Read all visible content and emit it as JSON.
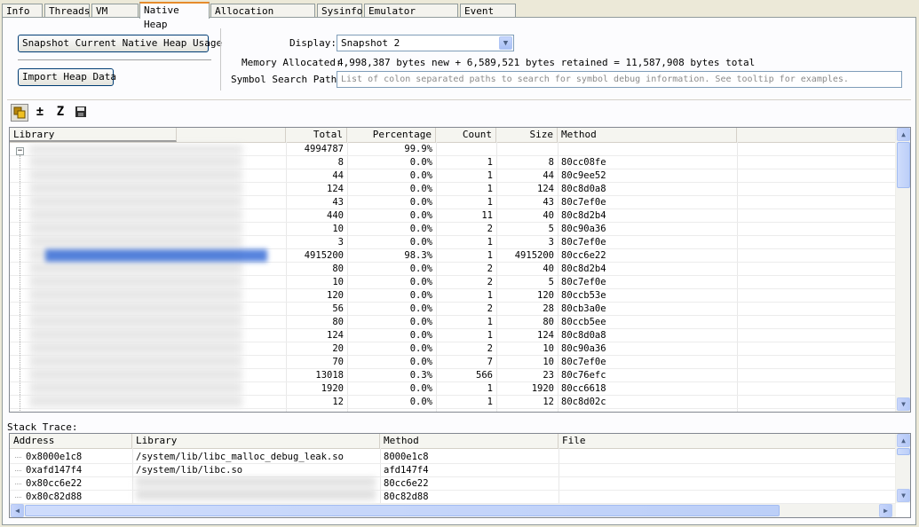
{
  "tabs": [
    "Info",
    "Threads",
    "VM Heap",
    "Native Heap",
    "Allocation Tracker",
    "Sysinfo",
    "Emulator Control",
    "Event Log"
  ],
  "buttons": {
    "snapshot": "Snapshot Current Native Heap Usage",
    "import": "Import Heap Data"
  },
  "display": {
    "label": "Display:",
    "value": "Snapshot 2"
  },
  "memory": {
    "label": "Memory Allocated:",
    "value": "4,998,387 bytes new + 6,589,521 bytes retained = 11,587,908 bytes total"
  },
  "symbol": {
    "label": "Symbol Search Path:",
    "placeholder": "List of colon separated paths to search for symbol debug information. See tooltip for examples."
  },
  "toolbar": {
    "icons": [
      "stacked-library-icon",
      "plus-minus-icon",
      "zygote-z-icon",
      "save-disk-icon"
    ],
    "plusminus_glyph": "±",
    "z_glyph": "Z"
  },
  "heap_table": {
    "columns": [
      "Library",
      "Total",
      "Percentage",
      "Count",
      "Size",
      "Method"
    ],
    "rows": [
      {
        "total": "4994787",
        "pct": "99.9%",
        "count": "",
        "size": "",
        "method": ""
      },
      {
        "total": "8",
        "pct": "0.0%",
        "count": "1",
        "size": "8",
        "method": "80cc08fe"
      },
      {
        "total": "44",
        "pct": "0.0%",
        "count": "1",
        "size": "44",
        "method": "80c9ee52"
      },
      {
        "total": "124",
        "pct": "0.0%",
        "count": "1",
        "size": "124",
        "method": "80c8d0a8"
      },
      {
        "total": "43",
        "pct": "0.0%",
        "count": "1",
        "size": "43",
        "method": "80c7ef0e"
      },
      {
        "total": "440",
        "pct": "0.0%",
        "count": "11",
        "size": "40",
        "method": "80c8d2b4"
      },
      {
        "total": "10",
        "pct": "0.0%",
        "count": "2",
        "size": "5",
        "method": "80c90a36"
      },
      {
        "total": "3",
        "pct": "0.0%",
        "count": "1",
        "size": "3",
        "method": "80c7ef0e"
      },
      {
        "total": "4915200",
        "pct": "98.3%",
        "count": "1",
        "size": "4915200",
        "method": "80cc6e22"
      },
      {
        "total": "80",
        "pct": "0.0%",
        "count": "2",
        "size": "40",
        "method": "80c8d2b4"
      },
      {
        "total": "10",
        "pct": "0.0%",
        "count": "2",
        "size": "5",
        "method": "80c7ef0e"
      },
      {
        "total": "120",
        "pct": "0.0%",
        "count": "1",
        "size": "120",
        "method": "80ccb53e"
      },
      {
        "total": "56",
        "pct": "0.0%",
        "count": "2",
        "size": "28",
        "method": "80cb3a0e"
      },
      {
        "total": "80",
        "pct": "0.0%",
        "count": "1",
        "size": "80",
        "method": "80ccb5ee"
      },
      {
        "total": "124",
        "pct": "0.0%",
        "count": "1",
        "size": "124",
        "method": "80c8d0a8"
      },
      {
        "total": "20",
        "pct": "0.0%",
        "count": "2",
        "size": "10",
        "method": "80c90a36"
      },
      {
        "total": "70",
        "pct": "0.0%",
        "count": "7",
        "size": "10",
        "method": "80c7ef0e"
      },
      {
        "total": "13018",
        "pct": "0.3%",
        "count": "566",
        "size": "23",
        "method": "80c76efc"
      },
      {
        "total": "1920",
        "pct": "0.0%",
        "count": "1",
        "size": "1920",
        "method": "80cc6618"
      },
      {
        "total": "12",
        "pct": "0.0%",
        "count": "1",
        "size": "12",
        "method": "80c8d02c"
      }
    ]
  },
  "stack": {
    "label": "Stack Trace:",
    "columns": [
      "Address",
      "Library",
      "Method",
      "File"
    ],
    "rows": [
      {
        "address": "0x8000e1c8",
        "library": "/system/lib/libc_malloc_debug_leak.so",
        "method": "8000e1c8",
        "file": ""
      },
      {
        "address": "0xafd147f4",
        "library": "/system/lib/libc.so",
        "method": "afd147f4",
        "file": ""
      },
      {
        "address": "0x80cc6e22",
        "library": "",
        "method": "80cc6e22",
        "file": ""
      },
      {
        "address": "0x80c82d88",
        "library": "",
        "method": "80c82d88",
        "file": ""
      }
    ]
  },
  "colors": {
    "selection_highlight": "#3a6fd8",
    "tab_accent": "#e68b2c"
  }
}
